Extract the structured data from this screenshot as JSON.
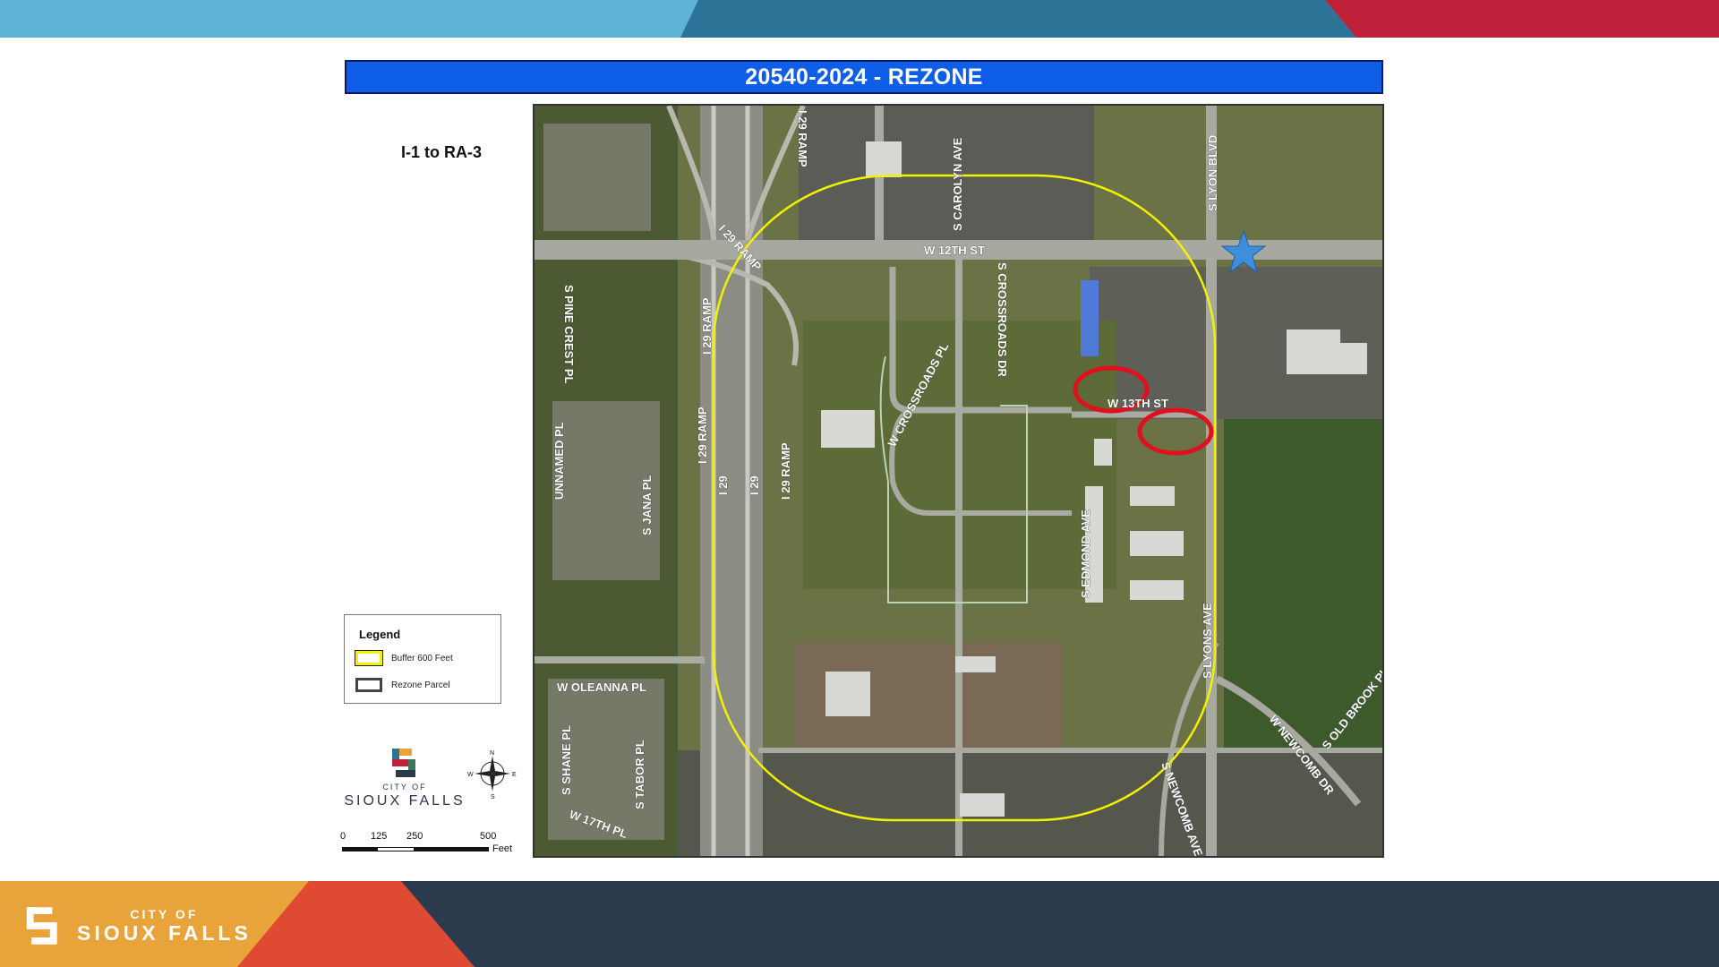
{
  "title": "20540-2024 - REZONE",
  "zoning_change": "I-1 to RA-3",
  "legend": {
    "title": "Legend",
    "items": [
      {
        "label": "Buffer  600 Feet",
        "color": "#f2f200"
      },
      {
        "label": "Rezone Parcel",
        "color": "#444444"
      }
    ]
  },
  "logo": {
    "city_of": "CITY OF",
    "name": "SIOUX FALLS"
  },
  "footer_logo": {
    "city_of": "CITY OF",
    "name": "SIOUX FALLS"
  },
  "compass": {
    "n": "N",
    "s": "S",
    "e": "E",
    "w": "W"
  },
  "scale": {
    "ticks": [
      "0",
      "125",
      "250",
      "500"
    ],
    "unit": "Feet"
  },
  "streets": {
    "w12": "W 12TH ST",
    "w13": "W 13TH ST",
    "carolyn": "S CAROLYN AVE",
    "lyon": "S LYON BLVD",
    "lyons": "S LYONS AVE",
    "crossroads_dr": "S CROSSROADS DR",
    "crossroads_pl": "W CROSSROADS PL",
    "sedmond": "S EDMOND AVE",
    "ramp1": "I 29 RAMP",
    "ramp2": "I 29 RAMP",
    "ramp3": "I 29 RAMP",
    "ramp4": "I 29 RAMP",
    "ramp5": "I 29 RAMP",
    "i29a": "I 29",
    "i29b": "I 29",
    "pinecrest": "S PINE CREST PL",
    "unnamed": "UNNAMED PL",
    "sjana": "S JANA PL",
    "oleanna": "W OLEANNA PL",
    "shane": "S SHANE PL",
    "tabor": "S TABOR PL",
    "w17": "W 17TH PL",
    "newcomb_ave": "S NEWCOMB AVE",
    "newcomb_dr": "W NEWCOMB DR",
    "oldbrook": "S OLD BROOK PL"
  },
  "colors": {
    "banner_light_blue": "#5fb4d6",
    "banner_teal": "#2d7397",
    "banner_red": "#c0213a",
    "title_blue": "#0e5ee8",
    "footer_navy": "#2c3a4d",
    "footer_orange": "#e8a43a",
    "footer_red": "#de4a32",
    "buffer_yellow": "#f2f200",
    "marker_red": "#e0101e",
    "star_blue": "#3e8edb"
  }
}
